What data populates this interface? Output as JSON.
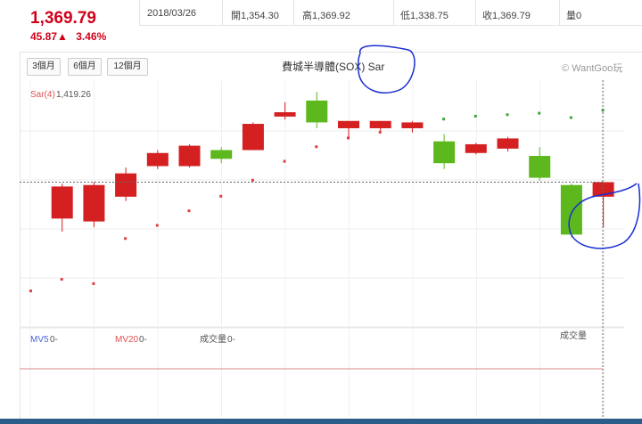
{
  "quote": {
    "price": "1,369.79",
    "change": "45.87▲",
    "change_pct": "3.46%"
  },
  "info_bar": {
    "date": "2018/03/26",
    "open": "開1,354.30",
    "high": "高1,369.92",
    "low": "低1,338.75",
    "close": "收1,369.79",
    "volume": "量0"
  },
  "toolbar": {
    "range_3m": "3個月",
    "range_6m": "6個月",
    "range_12m": "12個月"
  },
  "chart_title": "費城半導體(SOX) Sar",
  "copyright": "© WantGoo玩",
  "colors": {
    "up": "#d42020",
    "down": "#5cb81c",
    "sar_up": "#e04040",
    "sar_down": "#3aa93a",
    "accent": "#d0021b"
  },
  "chart_data": {
    "type": "candlestick",
    "title": "費城半導體(SOX) Sar",
    "indicator_label": "Sar(4)",
    "indicator_value": "1,419.26",
    "volume_labels": {
      "mv5": "MV5",
      "mv5_val": "0-",
      "mv20": "MV20",
      "mv20_val": "0-",
      "vol": "成交量",
      "vol_val": "0-",
      "vol_right": "成交量"
    },
    "ylim": [
      1270,
      1440
    ],
    "candles": [
      {
        "open": 1345,
        "close": 1367,
        "high": 1369,
        "low": 1336,
        "sar": 1303
      },
      {
        "open": 1343,
        "close": 1368,
        "high": 1370,
        "low": 1339,
        "sar": 1300
      },
      {
        "open": 1360,
        "close": 1376,
        "high": 1380,
        "low": 1357,
        "sar": 1331
      },
      {
        "open": 1381,
        "close": 1390,
        "high": 1392,
        "low": 1379,
        "sar": 1340
      },
      {
        "open": 1381,
        "close": 1395,
        "high": 1396,
        "low": 1380,
        "sar": 1350
      },
      {
        "open": 1392,
        "close": 1386,
        "high": 1394,
        "low": 1383,
        "sar": 1360
      },
      {
        "open": 1392,
        "close": 1410,
        "high": 1411,
        "low": 1392,
        "sar": 1371
      },
      {
        "open": 1415,
        "close": 1418,
        "high": 1425,
        "low": 1413,
        "sar": 1384
      },
      {
        "open": 1426,
        "close": 1411,
        "high": 1432,
        "low": 1407,
        "sar": 1394
      },
      {
        "open": 1407,
        "close": 1412,
        "high": 1412,
        "low": 1400,
        "sar": 1400
      },
      {
        "open": 1407,
        "close": 1412,
        "high": 1412,
        "low": 1405,
        "sar": 1404
      },
      {
        "open": 1407,
        "close": 1411,
        "high": 1412,
        "low": 1404,
        "sar": 1409
      },
      {
        "open": 1398,
        "close": 1383,
        "high": 1403,
        "low": 1379,
        "sar": 1413
      },
      {
        "open": 1390,
        "close": 1396,
        "high": 1397,
        "low": 1389,
        "sar": 1415
      },
      {
        "open": 1393,
        "close": 1400,
        "high": 1401,
        "low": 1391,
        "sar": 1416
      },
      {
        "open": 1388,
        "close": 1373,
        "high": 1394,
        "low": 1371,
        "sar": 1417
      },
      {
        "open": 1368,
        "close": 1334,
        "high": 1369,
        "low": 1332,
        "sar": 1414
      },
      {
        "open": 1360,
        "close": 1370,
        "high": 1370,
        "low": 1339,
        "sar": 1419
      }
    ],
    "crosshair_y": 1370
  }
}
